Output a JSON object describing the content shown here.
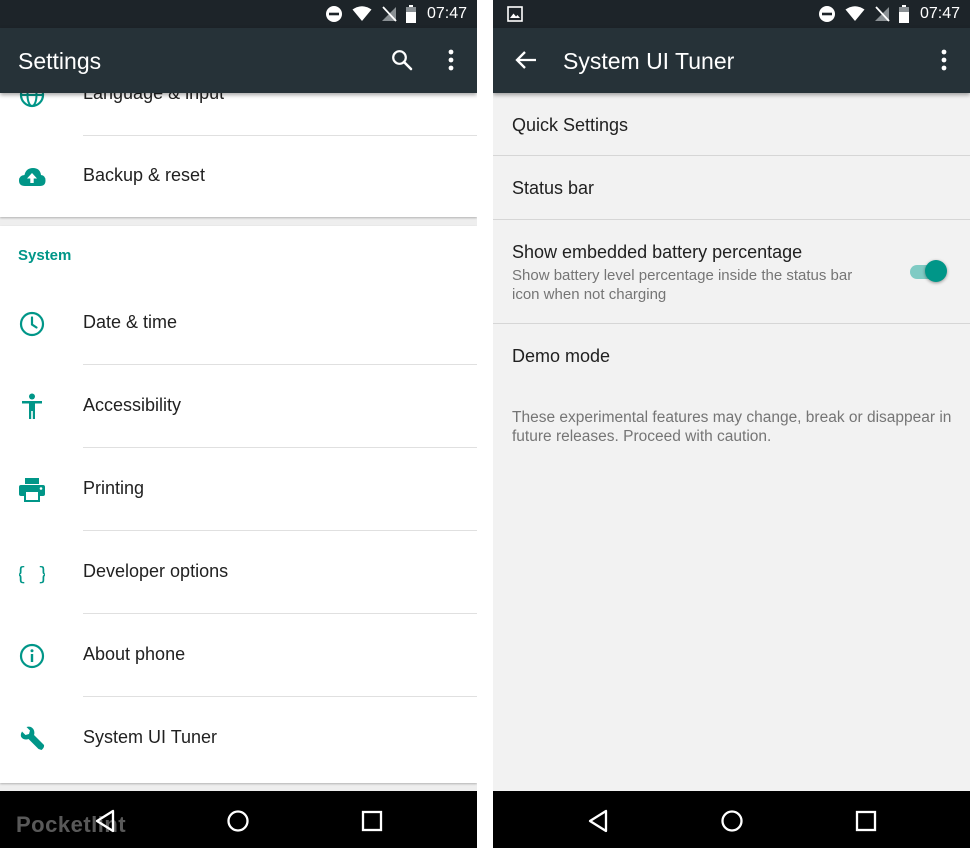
{
  "left": {
    "status_time": "07:47",
    "title": "Settings",
    "partial_item": "Language & input",
    "backup_item": "Backup & reset",
    "section_header": "System",
    "items": [
      {
        "label": "Date & time",
        "icon": "clock-icon"
      },
      {
        "label": "Accessibility",
        "icon": "accessibility-icon"
      },
      {
        "label": "Printing",
        "icon": "printer-icon"
      },
      {
        "label": "Developer options",
        "icon": "braces-icon"
      },
      {
        "label": "About phone",
        "icon": "info-icon"
      },
      {
        "label": "System UI Tuner",
        "icon": "wrench-icon"
      }
    ],
    "watermark": "Pocketlint"
  },
  "right": {
    "status_time": "07:47",
    "title": "System UI Tuner",
    "quick_settings": "Quick Settings",
    "status_bar": "Status bar",
    "battery": {
      "title": "Show embedded battery percentage",
      "subtitle": "Show battery level percentage inside the status bar icon when not charging",
      "enabled": true
    },
    "demo_mode": "Demo mode",
    "footnote": "These experimental features may change, break or disappear in future releases. Proceed with caution."
  },
  "colors": {
    "accent": "#009688",
    "appbar": "#263238",
    "statusbar": "#1d2429"
  }
}
